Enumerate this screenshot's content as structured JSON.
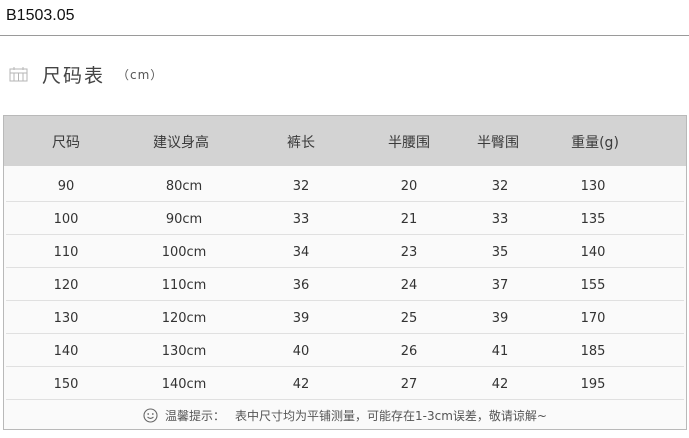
{
  "product_code": "B1503.05",
  "heading": {
    "title": "尺码表",
    "unit": "（cm）",
    "icon": "ruler-icon"
  },
  "table": {
    "columns": [
      "尺码",
      "建议身高",
      "裤长",
      "半腰围",
      "半臀围",
      "重量(g)"
    ],
    "rows": [
      [
        "90",
        "80cm",
        "32",
        "20",
        "32",
        "130"
      ],
      [
        "100",
        "90cm",
        "33",
        "21",
        "33",
        "135"
      ],
      [
        "110",
        "100cm",
        "34",
        "23",
        "35",
        "140"
      ],
      [
        "120",
        "110cm",
        "36",
        "24",
        "37",
        "155"
      ],
      [
        "130",
        "120cm",
        "39",
        "25",
        "39",
        "170"
      ],
      [
        "140",
        "130cm",
        "40",
        "26",
        "41",
        "185"
      ],
      [
        "150",
        "140cm",
        "42",
        "27",
        "42",
        "195"
      ]
    ]
  },
  "tip": {
    "icon": "smiley-icon",
    "label": "温馨提示：",
    "text": "表中尺寸均为平铺测量，可能存在1-3cm误差，敬请谅解~"
  },
  "colors": {
    "header_bg": "#d3d3d3",
    "table_bg": "#fafafa",
    "text": "#333333"
  }
}
